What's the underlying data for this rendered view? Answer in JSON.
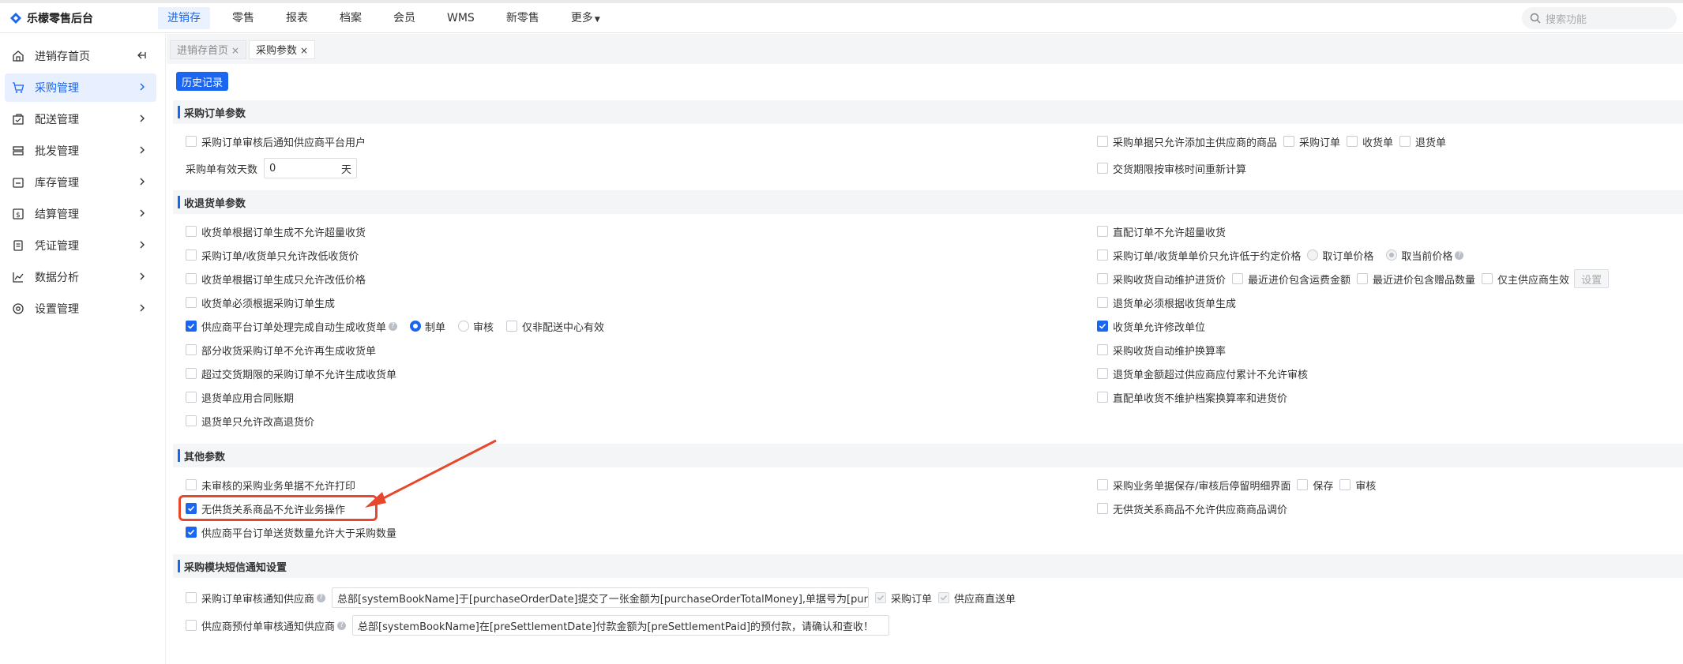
{
  "app": {
    "title": "乐檬零售后台"
  },
  "topnav": {
    "items": [
      "进销存",
      "零售",
      "报表",
      "档案",
      "会员",
      "WMS",
      "新零售",
      "更多"
    ],
    "search_placeholder": "搜索功能"
  },
  "sidebar": {
    "items": [
      {
        "label": "进销存首页",
        "icon": "home-icon"
      },
      {
        "label": "采购管理",
        "icon": "cart-icon"
      },
      {
        "label": "配送管理",
        "icon": "box-icon"
      },
      {
        "label": "批发管理",
        "icon": "server-icon"
      },
      {
        "label": "库存管理",
        "icon": "inventory-icon"
      },
      {
        "label": "结算管理",
        "icon": "money-icon"
      },
      {
        "label": "凭证管理",
        "icon": "document-icon"
      },
      {
        "label": "数据分析",
        "icon": "chart-icon"
      },
      {
        "label": "设置管理",
        "icon": "settings-icon"
      }
    ]
  },
  "tabs": [
    {
      "label": "进销存首页",
      "close": "×"
    },
    {
      "label": "采购参数",
      "close": "×"
    }
  ],
  "history_button": "历史记录",
  "sections": {
    "purchase_order": {
      "title": "采购订单参数",
      "notify_supplier": "采购订单审核后通知供应商平台用户",
      "valid_days_label": "采购单有效天数",
      "valid_days_value": "0",
      "valid_days_unit": "天",
      "only_main_supplier": "采购单据只允许添加主供应商的商品",
      "opt_po": "采购订单",
      "opt_receipt": "收货单",
      "opt_return": "退货单",
      "delivery_recalc": "交货期限按审核时间重新计算"
    },
    "receipt_return": {
      "title": "收退货单参数",
      "left": [
        "收货单根据订单生成不允许超量收货",
        "采购订单/收货单只允许改低收货价",
        "收货单根据订单生成只允许改低价格",
        "收货单必须根据采购订单生成",
        "供应商平台订单处理完成自动生成收货单",
        "部分收货采购订单不允许再生成收货单",
        "超过交货期限的采购订单不允许生成收货单",
        "退货单应用合同账期",
        "退货单只允许改高退货价"
      ],
      "auto_gen_opts": {
        "draft": "制单",
        "audit": "审核",
        "non_center": "仅非配送中心有效"
      },
      "right": [
        "直配订单不允许超量收货",
        "采购订单/收货单单价只允许低于约定价格",
        "采购收货自动维护进货价",
        "退货单必须根据收货单生成",
        "收货单允许修改单位",
        "采购收货自动维护换算率",
        "退货单金额超过供应商应付累计不允许审核",
        "直配单收货不维护档案换算率和进货价"
      ],
      "price_opts": {
        "order_price": "取订单价格",
        "current_price": "取当前价格"
      },
      "maintain_opts": {
        "freight": "最近进价包含运费金额",
        "gift": "最近进价包含赠品数量",
        "main_only": "仅主供应商生效",
        "setting": "设置"
      }
    },
    "other": {
      "title": "其他参数",
      "left": [
        "未审核的采购业务单据不允许打印",
        "无供货关系商品不允许业务操作",
        "供应商平台订单送货数量允许大于采购数量"
      ],
      "stay_detail": "采购业务单据保存/审核后停留明细界面",
      "stay_save": "保存",
      "stay_audit": "审核",
      "no_supply_price": "无供货关系商品不允许供应商商品调价"
    },
    "sms": {
      "title": "采购模块短信通知设置",
      "po_notify": "采购订单审核通知供应商",
      "po_template": "总部[systemBookName]于[purchaseOrderDate]提交了一张金额为[purchaseOrderTotalMoney],单据号为[purc",
      "po_opt1": "采购订单",
      "po_opt2": "供应商直送单",
      "prepay_notify": "供应商预付单审核通知供应商",
      "prepay_template": "总部[systemBookName]在[preSettlementDate]付款金额为[preSettlementPaid]的预付款，请确认和查收！"
    }
  },
  "colors": {
    "accent": "#1a66f0",
    "annotation": "#e7472d"
  }
}
